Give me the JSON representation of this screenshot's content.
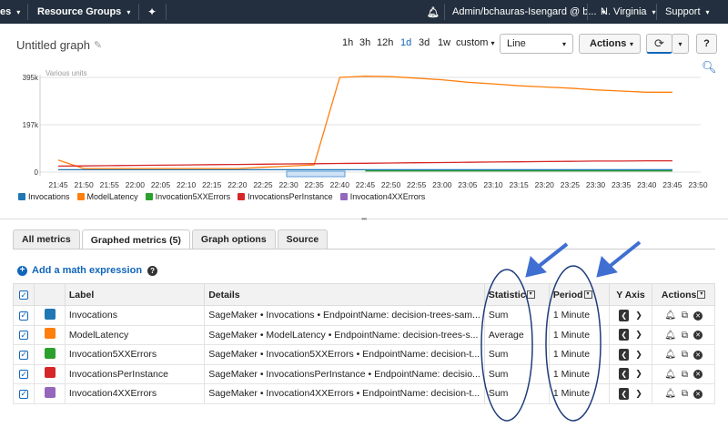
{
  "nav": {
    "partial_left": "es",
    "resource_groups": "Resource Groups",
    "account": "Admin/bchauras-Isengard @ b...",
    "region": "N. Virginia",
    "support": "Support"
  },
  "graph": {
    "title": "Untitled graph",
    "ranges": [
      "1h",
      "3h",
      "12h",
      "1d",
      "3d",
      "1w",
      "custom"
    ],
    "active_range": "1d",
    "chart_type": "Line",
    "actions_label": "Actions",
    "help": "?"
  },
  "chart_data": {
    "type": "line",
    "ylabel": "Various units",
    "y_ticks": [
      "395k",
      "197k",
      "0"
    ],
    "ylim": [
      0,
      395000
    ],
    "x": [
      "21:45",
      "21:50",
      "21:55",
      "22:00",
      "22:05",
      "22:10",
      "22:15",
      "22:20",
      "22:25",
      "22:30",
      "22:35",
      "22:40",
      "22:45",
      "22:50",
      "22:55",
      "23:00",
      "23:05",
      "23:10",
      "23:15",
      "23:20",
      "23:25",
      "23:30",
      "23:35",
      "23:40",
      "23:45",
      "23:50"
    ],
    "series": [
      {
        "name": "Invocations",
        "color": "#1f77b4",
        "values": [
          10000,
          10000,
          10000,
          10000,
          10000,
          10000,
          10000,
          10000,
          10000,
          10000,
          10000,
          10000,
          10000,
          10000,
          10000,
          10000,
          10000,
          10000,
          10000,
          10000,
          10000,
          10000,
          10000,
          10000,
          10000,
          null
        ]
      },
      {
        "name": "ModelLatency",
        "color": "#ff7f0e",
        "values": [
          50000,
          15000,
          15000,
          15000,
          15000,
          15000,
          15000,
          15000,
          20000,
          25000,
          30000,
          395000,
          400000,
          398000,
          392000,
          385000,
          375000,
          368000,
          360000,
          355000,
          350000,
          343000,
          338000,
          333000,
          333000,
          null
        ]
      },
      {
        "name": "Invocation5XXErrors",
        "color": "#2ca02c",
        "values": [
          null,
          null,
          null,
          null,
          null,
          null,
          null,
          null,
          null,
          null,
          null,
          null,
          5000,
          5000,
          5000,
          5000,
          5000,
          5000,
          5000,
          5000,
          5000,
          5000,
          5000,
          5000,
          5000,
          null
        ]
      },
      {
        "name": "InvocationsPerInstance",
        "color": "#d62728",
        "values": [
          25000,
          26000,
          27000,
          28000,
          29000,
          30000,
          31000,
          32000,
          33000,
          34000,
          35000,
          36000,
          37000,
          38000,
          39000,
          40000,
          41000,
          42000,
          43000,
          44000,
          45000,
          46000,
          46000,
          47000,
          47000,
          null
        ]
      },
      {
        "name": "Invocation4XXErrors",
        "color": "#9467bd",
        "values": [
          null,
          null,
          null,
          null,
          null,
          null,
          null,
          null,
          null,
          null,
          null,
          null,
          null,
          null,
          null,
          null,
          null,
          null,
          null,
          null,
          null,
          null,
          null,
          null,
          null,
          null
        ]
      }
    ]
  },
  "tabs": [
    "All metrics",
    "Graphed metrics (5)",
    "Graph options",
    "Source"
  ],
  "active_tab": "Graphed metrics (5)",
  "add_math": "Add a math expression",
  "table": {
    "headers": {
      "label": "Label",
      "details": "Details",
      "statistic": "Statistic",
      "period": "Period",
      "yaxis": "Y Axis",
      "actions": "Actions"
    },
    "rows": [
      {
        "color": "#1f77b4",
        "label": "Invocations",
        "details": "SageMaker • Invocations • EndpointName: decision-trees-sam...",
        "statistic": "Sum",
        "period": "1 Minute"
      },
      {
        "color": "#ff7f0e",
        "label": "ModelLatency",
        "details": "SageMaker • ModelLatency • EndpointName: decision-trees-s...",
        "statistic": "Average",
        "period": "1 Minute"
      },
      {
        "color": "#2ca02c",
        "label": "Invocation5XXErrors",
        "details": "SageMaker • Invocation5XXErrors • EndpointName: decision-t...",
        "statistic": "Sum",
        "period": "1 Minute"
      },
      {
        "color": "#d62728",
        "label": "InvocationsPerInstance",
        "details": "SageMaker • InvocationsPerInstance • EndpointName: decisio...",
        "statistic": "Sum",
        "period": "1 Minute"
      },
      {
        "color": "#9467bd",
        "label": "Invocation4XXErrors",
        "details": "SageMaker • Invocation4XXErrors • EndpointName: decision-t...",
        "statistic": "Sum",
        "period": "1 Minute"
      }
    ]
  },
  "icons": {
    "bell": "bell-icon",
    "pin": "pin-icon",
    "refresh": "refresh-icon",
    "zoom": "zoom-icon",
    "pencil": "pencil-icon",
    "alarm": "alarm-icon",
    "copy": "copy-icon",
    "remove": "remove-icon"
  }
}
